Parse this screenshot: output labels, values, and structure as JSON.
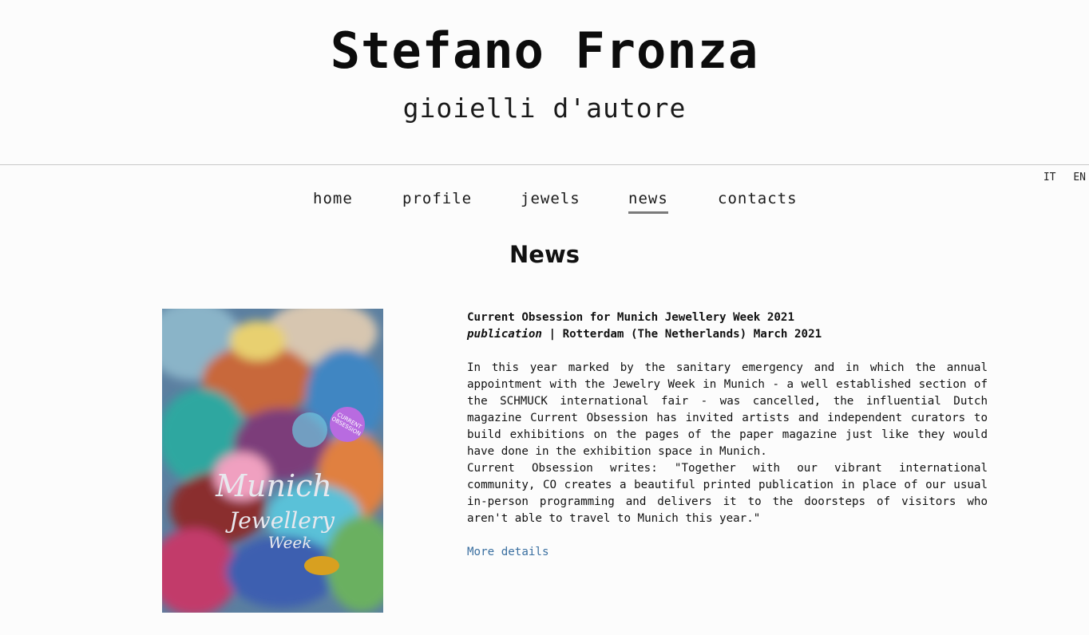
{
  "site": {
    "title": "Stefano Fronza",
    "subtitle": "gioielli d'autore"
  },
  "lang": [
    "IT",
    "EN"
  ],
  "nav": {
    "items": [
      {
        "label": "home",
        "active": false
      },
      {
        "label": "profile",
        "active": false
      },
      {
        "label": "jewels",
        "active": false
      },
      {
        "label": "news",
        "active": true
      },
      {
        "label": "contacts",
        "active": false
      }
    ]
  },
  "page": {
    "heading": "News"
  },
  "article": {
    "title": "Current Obsession for Munich Jewellery Week 2021",
    "meta_type": "publication",
    "meta_rest": " | Rotterdam (The Netherlands) March 2021",
    "paragraph1": "In this year marked by the sanitary emergency and in which the annual appointment with the Jewelry Week in Munich - a well established section of the SCHMUCK international fair - was cancelled, the influential Dutch magazine Current Obsession has invited artists and independent curators to build exhibitions on the pages of the paper magazine just like they would have done in the exhibition space in Munich.",
    "paragraph2": "Current Obsession writes: \"Together with our vibrant international community, CO creates a beautiful printed publication in place of our usual in-person programming and delivers it to the doorsteps of visitors who aren't able to travel to Munich this year.\"",
    "more_label": "More details",
    "cover": {
      "badge": "CURRENT OBSESSION",
      "line1": "Munich",
      "line2": "Jewellery",
      "line3": "Week"
    }
  },
  "colors": {
    "link": "#3a6fa0",
    "nav_underline": "#7a7a7a",
    "badge": "#b86be0"
  }
}
